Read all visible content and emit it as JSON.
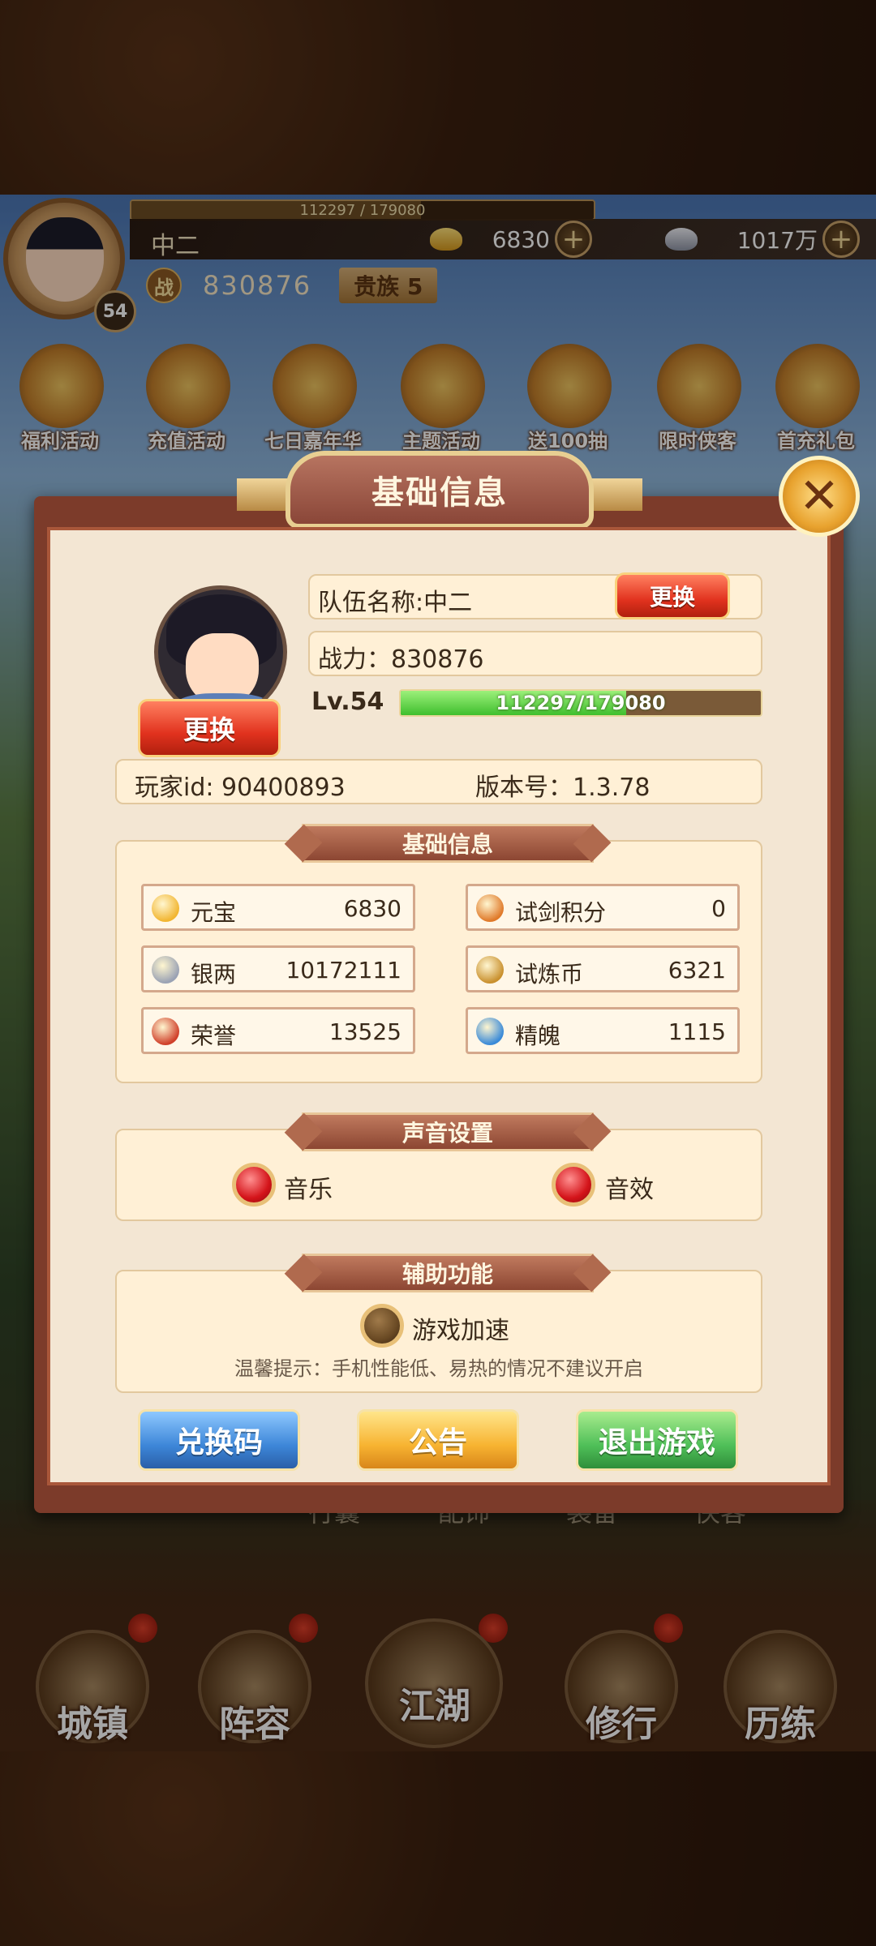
{
  "hud": {
    "exp_text": "112297 / 179080",
    "player_name": "中二",
    "level": "54",
    "gold": "6830",
    "silver": "1017万",
    "power_icon": "战",
    "power": "830876",
    "noble": "贵族 5",
    "plus": "+"
  },
  "activities": [
    {
      "label": "福利活动"
    },
    {
      "label": "充值活动"
    },
    {
      "label": "七日嘉年华"
    },
    {
      "label": "主题活动"
    },
    {
      "label": "送100抽"
    },
    {
      "label": "限时侠客"
    },
    {
      "label": "首充礼包"
    }
  ],
  "dialog": {
    "title": "基础信息",
    "close": "✕",
    "team_name": "队伍名称:中二",
    "change_label": "更换",
    "power": "战力：830876",
    "level": "Lv.54",
    "exp": "112297/179080",
    "exp_fraction": 0.627,
    "player_id": "玩家id: 90400893",
    "version": "版本号：1.3.78",
    "basic_section": "基础信息",
    "stats": [
      {
        "name": "元宝",
        "value": "6830",
        "icon": "gold-ingot-icon",
        "color": "#f2b632"
      },
      {
        "name": "试剑积分",
        "value": "0",
        "icon": "sword-token-icon",
        "color": "#e07a2a"
      },
      {
        "name": "银两",
        "value": "10172111",
        "icon": "silver-ingot-icon",
        "color": "#9aa2b4"
      },
      {
        "name": "试炼币",
        "value": "6321",
        "icon": "trial-coin-icon",
        "color": "#c9902e"
      },
      {
        "name": "荣誉",
        "value": "13525",
        "icon": "honor-icon",
        "color": "#d0402a"
      },
      {
        "name": "精魄",
        "value": "1115",
        "icon": "spirit-icon",
        "color": "#3a8ad8"
      }
    ],
    "sound_section": "声音设置",
    "music": "音乐",
    "sfx": "音效",
    "assist_section": "辅助功能",
    "speed": "游戏加速",
    "tip": "温馨提示：手机性能低、易热的情况不建议开启",
    "redeem": "兑换码",
    "notice": "公告",
    "logout": "退出游戏"
  },
  "sub_nav": [
    "行囊",
    "配饰",
    "装备",
    "侠客"
  ],
  "nav": [
    "城镇",
    "阵容",
    "江湖",
    "修行",
    "历练"
  ]
}
